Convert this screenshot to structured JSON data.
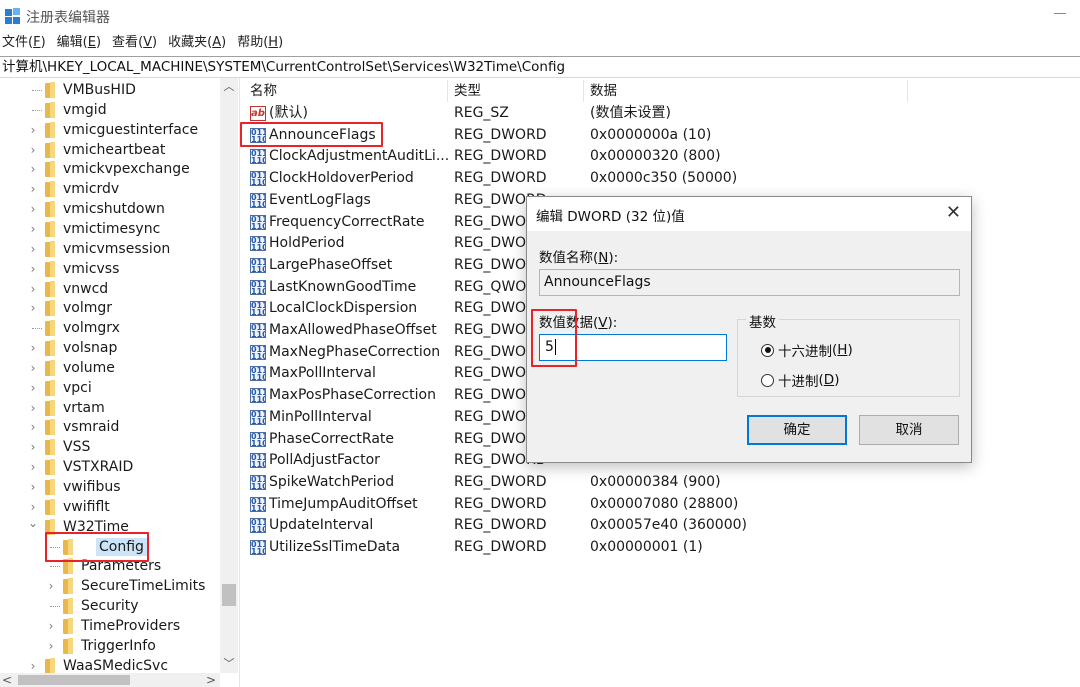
{
  "window": {
    "title": "注册表编辑器"
  },
  "menu": [
    {
      "label": "文件",
      "key": "F"
    },
    {
      "label": "编辑",
      "key": "E"
    },
    {
      "label": "查看",
      "key": "V"
    },
    {
      "label": "收藏夹",
      "key": "A"
    },
    {
      "label": "帮助",
      "key": "H"
    }
  ],
  "address": "计算机\\HKEY_LOCAL_MACHINE\\SYSTEM\\CurrentControlSet\\Services\\W32Time\\Config",
  "tree": [
    {
      "label": "VMBusHID",
      "expander": "none",
      "level": 0
    },
    {
      "label": "vmgid",
      "expander": "none",
      "level": 0
    },
    {
      "label": "vmicguestinterface",
      "expander": "collapsed",
      "level": 0
    },
    {
      "label": "vmicheartbeat",
      "expander": "collapsed",
      "level": 0
    },
    {
      "label": "vmickvpexchange",
      "expander": "collapsed",
      "level": 0
    },
    {
      "label": "vmicrdv",
      "expander": "collapsed",
      "level": 0
    },
    {
      "label": "vmicshutdown",
      "expander": "collapsed",
      "level": 0
    },
    {
      "label": "vmictimesync",
      "expander": "collapsed",
      "level": 0
    },
    {
      "label": "vmicvmsession",
      "expander": "collapsed",
      "level": 0
    },
    {
      "label": "vmicvss",
      "expander": "collapsed",
      "level": 0
    },
    {
      "label": "vnwcd",
      "expander": "collapsed",
      "level": 0
    },
    {
      "label": "volmgr",
      "expander": "collapsed",
      "level": 0
    },
    {
      "label": "volmgrx",
      "expander": "none",
      "level": 0
    },
    {
      "label": "volsnap",
      "expander": "collapsed",
      "level": 0
    },
    {
      "label": "volume",
      "expander": "collapsed",
      "level": 0
    },
    {
      "label": "vpci",
      "expander": "collapsed",
      "level": 0
    },
    {
      "label": "vrtam",
      "expander": "collapsed",
      "level": 0
    },
    {
      "label": "vsmraid",
      "expander": "collapsed",
      "level": 0
    },
    {
      "label": "VSS",
      "expander": "collapsed",
      "level": 0
    },
    {
      "label": "VSTXRAID",
      "expander": "collapsed",
      "level": 0
    },
    {
      "label": "vwifibus",
      "expander": "collapsed",
      "level": 0
    },
    {
      "label": "vwififlt",
      "expander": "collapsed",
      "level": 0
    },
    {
      "label": "W32Time",
      "expander": "expanded",
      "level": 0
    },
    {
      "label": "Config",
      "expander": "none",
      "level": 1,
      "selected": true
    },
    {
      "label": "Parameters",
      "expander": "none",
      "level": 1
    },
    {
      "label": "SecureTimeLimits",
      "expander": "collapsed",
      "level": 1
    },
    {
      "label": "Security",
      "expander": "none",
      "level": 1
    },
    {
      "label": "TimeProviders",
      "expander": "collapsed",
      "level": 1
    },
    {
      "label": "TriggerInfo",
      "expander": "collapsed",
      "level": 1
    },
    {
      "label": "WaaSMedicSvc",
      "expander": "collapsed",
      "level": 0
    }
  ],
  "columns": {
    "name": "名称",
    "type": "类型",
    "data": "数据"
  },
  "values": [
    {
      "name": "(默认)",
      "type": "REG_SZ",
      "data": "(数值未设置)",
      "icon": "string-value-icon"
    },
    {
      "name": "AnnounceFlags",
      "type": "REG_DWORD",
      "data": "0x0000000a (10)",
      "icon": "binary-value-icon"
    },
    {
      "name": "ClockAdjustmentAuditLi...",
      "type": "REG_DWORD",
      "data": "0x00000320 (800)",
      "icon": "binary-value-icon"
    },
    {
      "name": "ClockHoldoverPeriod",
      "type": "REG_DWORD",
      "data": "0x0000c350 (50000)",
      "icon": "binary-value-icon"
    },
    {
      "name": "EventLogFlags",
      "type": "REG_DWORD",
      "data": "",
      "icon": "binary-value-icon"
    },
    {
      "name": "FrequencyCorrectRate",
      "type": "REG_DWORD",
      "data": "",
      "icon": "binary-value-icon"
    },
    {
      "name": "HoldPeriod",
      "type": "REG_DWORD",
      "data": "",
      "icon": "binary-value-icon"
    },
    {
      "name": "LargePhaseOffset",
      "type": "REG_DWORD",
      "data": "",
      "icon": "binary-value-icon"
    },
    {
      "name": "LastKnownGoodTime",
      "type": "REG_QWORD",
      "data": "",
      "icon": "binary-value-icon"
    },
    {
      "name": "LocalClockDispersion",
      "type": "REG_DWORD",
      "data": "",
      "icon": "binary-value-icon"
    },
    {
      "name": "MaxAllowedPhaseOffset",
      "type": "REG_DWORD",
      "data": "",
      "icon": "binary-value-icon"
    },
    {
      "name": "MaxNegPhaseCorrection",
      "type": "REG_DWORD",
      "data": "",
      "icon": "binary-value-icon"
    },
    {
      "name": "MaxPollInterval",
      "type": "REG_DWORD",
      "data": "",
      "icon": "binary-value-icon"
    },
    {
      "name": "MaxPosPhaseCorrection",
      "type": "REG_DWORD",
      "data": "",
      "icon": "binary-value-icon"
    },
    {
      "name": "MinPollInterval",
      "type": "REG_DWORD",
      "data": "",
      "icon": "binary-value-icon"
    },
    {
      "name": "PhaseCorrectRate",
      "type": "REG_DWORD",
      "data": "",
      "icon": "binary-value-icon"
    },
    {
      "name": "PollAdjustFactor",
      "type": "REG_DWORD",
      "data": "",
      "icon": "binary-value-icon"
    },
    {
      "name": "SpikeWatchPeriod",
      "type": "REG_DWORD",
      "data": "0x00000384 (900)",
      "icon": "binary-value-icon"
    },
    {
      "name": "TimeJumpAuditOffset",
      "type": "REG_DWORD",
      "data": "0x00007080 (28800)",
      "icon": "binary-value-icon"
    },
    {
      "name": "UpdateInterval",
      "type": "REG_DWORD",
      "data": "0x00057e40 (360000)",
      "icon": "binary-value-icon"
    },
    {
      "name": "UtilizeSslTimeData",
      "type": "REG_DWORD",
      "data": "0x00000001 (1)",
      "icon": "binary-value-icon"
    }
  ],
  "dialog": {
    "title": "编辑 DWORD (32 位)值",
    "name_label": "数值名称",
    "name_key": "N",
    "name_value": "AnnounceFlags",
    "data_label": "数值数据",
    "data_key": "V",
    "data_value": "5",
    "base_label": "基数",
    "radio_hex": "十六进制",
    "radio_hex_key": "H",
    "radio_dec": "十进制",
    "radio_dec_key": "D",
    "selected_base": "hex",
    "ok": "确定",
    "cancel": "取消"
  },
  "colors": {
    "highlight": "#e8232a",
    "selection": "#cce4f7",
    "accent": "#0078d7"
  }
}
